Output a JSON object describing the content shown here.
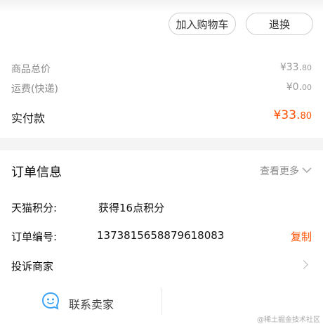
{
  "actions": {
    "add_to_cart": "加入购物车",
    "exchange": "退换"
  },
  "summary": {
    "goods_total_label": "商品总价",
    "goods_total_symbol": "¥",
    "goods_total_int": "33.",
    "goods_total_dec": "80",
    "shipping_label": "运费(快递)",
    "shipping_symbol": "¥",
    "shipping_int": "0.",
    "shipping_dec": "00",
    "paid_label": "实付款",
    "paid_symbol": "¥",
    "paid_int": "33.",
    "paid_dec": "80"
  },
  "order": {
    "title": "订单信息",
    "view_more": "查看更多",
    "points_label": "天猫积分:",
    "points_value": "获得16点积分",
    "number_label": "订单编号:",
    "number_value": "1373815658879618083",
    "copy_label": "复制",
    "complaint_label": "投诉商家"
  },
  "footer": {
    "contact_seller": "联系卖家",
    "watermark": "@稀土掘金技术社区"
  },
  "colors": {
    "accent": "#ff5000",
    "icon_blue": "#3aa3f5"
  }
}
